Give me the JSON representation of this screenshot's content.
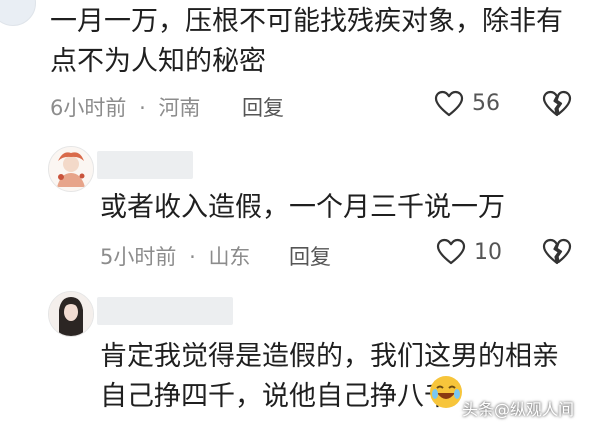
{
  "comments": [
    {
      "text_line1": "一月一万，压根不可能找残疾对象，除非有",
      "text_line2": "点不为人知的秘密",
      "time": "6小时前",
      "sep": "·",
      "location": "河南",
      "reply_label": "回复",
      "likes": "56"
    },
    {
      "text_line1": "或者收入造假，一个月三千说一万",
      "time": "5小时前",
      "sep": "·",
      "location": "山东",
      "reply_label": "回复",
      "likes": "10"
    },
    {
      "text_line1": "肯定我觉得是造假的，我们这男的相亲",
      "text_line2": "自己挣四千，说他自己挣八千"
    }
  ],
  "watermark": "头条@纵观人间",
  "colors": {
    "text": "#1f1f1f",
    "meta": "#8c8c8c",
    "icon": "#333333"
  }
}
